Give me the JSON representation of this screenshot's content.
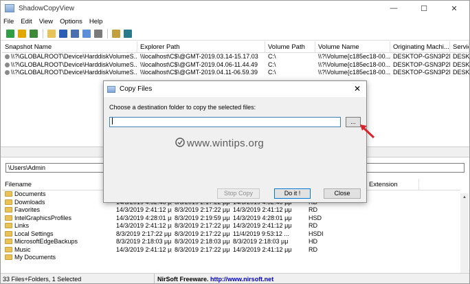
{
  "window": {
    "title": "ShadowCopyView",
    "minimize": "—",
    "maximize": "☐",
    "close": "✕"
  },
  "menu": [
    "File",
    "Edit",
    "View",
    "Options",
    "Help"
  ],
  "toolbar": {
    "icons": [
      "up-arrow-icon",
      "open-folder-icon",
      "copy-files-icon",
      "folder-icon",
      "save-icon",
      "floppy-icon",
      "copy-icon",
      "properties-icon",
      "html-report-icon",
      "exit-icon"
    ],
    "colors": [
      "#2f9e44",
      "#e0a800",
      "#3d8b37",
      "#e9c35a",
      "#2b5fb4",
      "#4a6fb0",
      "#5d8fd8",
      "#7a7a7a",
      "#c2a03e",
      "#2b7a8a"
    ]
  },
  "snapshots": {
    "columns": [
      "Snapshot Name",
      "Explorer Path",
      "Volume Path",
      "Volume Name",
      "Originating Machi...",
      "Servic"
    ],
    "rows": [
      [
        "\\\\?\\GLOBALROOT\\Device\\HarddiskVolumeS...",
        "\\\\localhost\\C$\\@GMT-2019.03.14-15.17.03",
        "C:\\",
        "\\\\?\\Volume{c185ec18-00...",
        "DESKTOP-GSN3P2N",
        "DESKT"
      ],
      [
        "\\\\?\\GLOBALROOT\\Device\\HarddiskVolumeS...",
        "\\\\localhost\\C$\\@GMT-2019.04.06-11.44.49",
        "C:\\",
        "\\\\?\\Volume{c185ec18-00...",
        "DESKTOP-GSN3P2N",
        "DESKT"
      ],
      [
        "\\\\?\\GLOBALROOT\\Device\\HarddiskVolumeS...",
        "\\\\localhost\\C$\\@GMT-2019.04.11-06.59.39",
        "C:\\",
        "\\\\?\\Volume{c185ec18-00...",
        "DESKTOP-GSN3P2N",
        "DESKT"
      ]
    ]
  },
  "path": "\\Users\\Admin",
  "files": {
    "columns": [
      "Filename",
      "",
      "",
      "",
      "es",
      "File Extension"
    ],
    "rows": [
      [
        "Documents",
        "",
        "",
        "",
        "",
        ""
      ],
      [
        "Downloads",
        "14/3/2019 4:52:46 μμ",
        "8/3/2019 2:17:22 μμ",
        "14/3/2019 4:52:46 μμ",
        "RD",
        ""
      ],
      [
        "Favorites",
        "14/3/2019 2:41:12 μμ",
        "8/3/2019 2:17:22 μμ",
        "14/3/2019 2:41:12 μμ",
        "RD",
        ""
      ],
      [
        "IntelGraphicsProfiles",
        "14/3/2019 4:28:01 μμ",
        "8/3/2019 2:19:59 μμ",
        "14/3/2019 4:28:01 μμ",
        "HSD",
        ""
      ],
      [
        "Links",
        "14/3/2019 2:41:12 μμ",
        "8/3/2019 2:17:22 μμ",
        "14/3/2019 2:41:12 μμ",
        "RD",
        ""
      ],
      [
        "Local Settings",
        "8/3/2019 2:17:22 μμ",
        "8/3/2019 2:17:22 μμ",
        "11/4/2019 9:53:12 ...",
        "HSDI",
        ""
      ],
      [
        "MicrosoftEdgeBackups",
        "8/3/2019 2:18:03 μμ",
        "8/3/2019 2:18:03 μμ",
        "8/3/2019 2:18:03 μμ",
        "HD",
        ""
      ],
      [
        "Music",
        "14/3/2019 2:41:12 μμ",
        "8/3/2019 2:17:22 μμ",
        "14/3/2019 2:41:12 μμ",
        "RD",
        ""
      ],
      [
        "My Documents",
        "",
        "",
        "",
        "",
        ""
      ]
    ]
  },
  "status": {
    "count": "33 Files+Folders, 1 Selected",
    "freeware": "NirSoft Freeware.  ",
    "url": "http://www.nirsoft.net"
  },
  "dialog": {
    "title": "Copy Files",
    "prompt": "Choose a destination folder to copy the selected files:",
    "input_value": "",
    "browse_label": "...",
    "stop_label": "Stop Copy",
    "doit_label": "Do it !",
    "close_label": "Close"
  },
  "watermark": "www.wintips.org",
  "accent_color": "#0078d7",
  "arrow_color": "#d9232a"
}
